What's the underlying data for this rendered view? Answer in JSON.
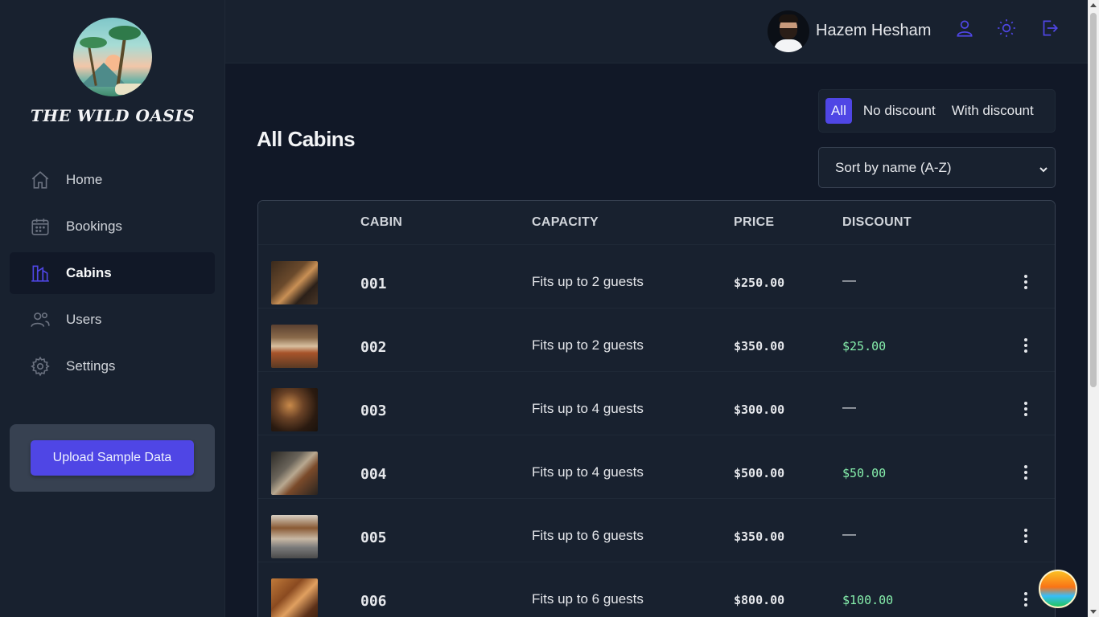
{
  "app": {
    "title": "THE WILD OASIS"
  },
  "sidebar": {
    "items": [
      {
        "label": "Home",
        "icon": "home-icon",
        "active": false
      },
      {
        "label": "Bookings",
        "icon": "calendar-icon",
        "active": false
      },
      {
        "label": "Cabins",
        "icon": "cabins-icon",
        "active": true
      },
      {
        "label": "Users",
        "icon": "users-icon",
        "active": false
      },
      {
        "label": "Settings",
        "icon": "gear-icon",
        "active": false
      }
    ],
    "upload_label": "Upload Sample Data"
  },
  "header": {
    "user_name": "Hazem Hesham",
    "icons": [
      "user-icon",
      "sun-icon",
      "logout-icon"
    ]
  },
  "main": {
    "title": "All Cabins",
    "filter": {
      "options": [
        "All",
        "No discount",
        "With discount"
      ],
      "selected": "All"
    },
    "sort": {
      "selected": "Sort by name (A-Z)"
    },
    "table": {
      "columns": [
        "",
        "CABIN",
        "CAPACITY",
        "PRICE",
        "DISCOUNT",
        ""
      ],
      "rows": [
        {
          "name": "001",
          "capacity": "Fits up to 2 guests",
          "price": "$250.00",
          "discount": "—"
        },
        {
          "name": "002",
          "capacity": "Fits up to 2 guests",
          "price": "$350.00",
          "discount": "$25.00"
        },
        {
          "name": "003",
          "capacity": "Fits up to 4 guests",
          "price": "$300.00",
          "discount": "—"
        },
        {
          "name": "004",
          "capacity": "Fits up to 4 guests",
          "price": "$500.00",
          "discount": "$50.00"
        },
        {
          "name": "005",
          "capacity": "Fits up to 6 guests",
          "price": "$350.00",
          "discount": "—"
        },
        {
          "name": "006",
          "capacity": "Fits up to 6 guests",
          "price": "$800.00",
          "discount": "$100.00"
        }
      ]
    }
  },
  "colors": {
    "accent": "#4f46e5",
    "background": "#111827",
    "surface": "#18212f",
    "discount_text": "#86efac"
  }
}
